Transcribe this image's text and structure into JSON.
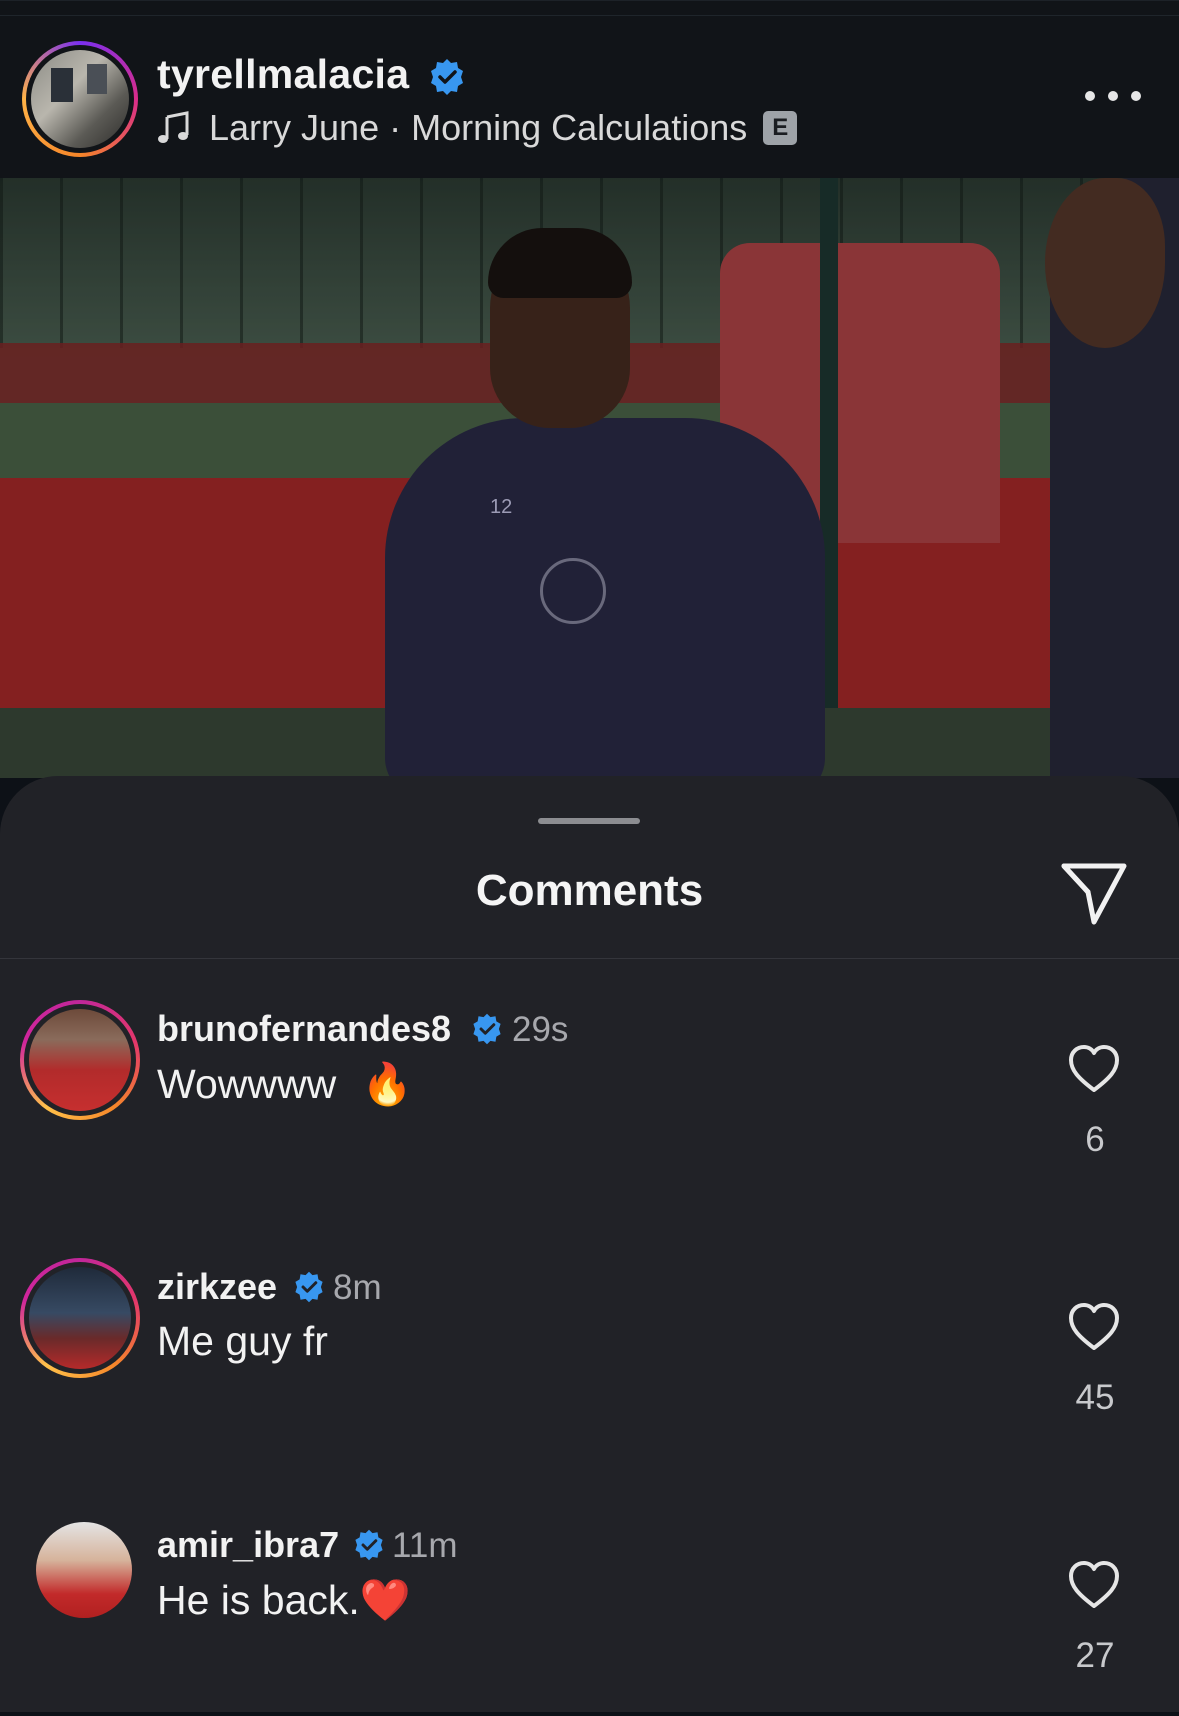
{
  "post": {
    "username": "tyrellmalacia",
    "music": "Larry June · Morning Calculations",
    "explicit_badge": "E",
    "verified_color": "#3897f0"
  },
  "photo": {
    "jersey_number": "12"
  },
  "sheet": {
    "title": "Comments"
  },
  "comments": [
    {
      "username": "brunofernandes8",
      "time": "29s",
      "text": "Wowwww",
      "emoji": "🔥",
      "likes": "6"
    },
    {
      "username": "zirkzee",
      "time": "8m",
      "text": "Me guy fr",
      "emoji": "",
      "likes": "45"
    },
    {
      "username": "amir_ibra7",
      "time": "11m",
      "text": "He is back.",
      "emoji": "❤️",
      "likes": "27"
    }
  ]
}
